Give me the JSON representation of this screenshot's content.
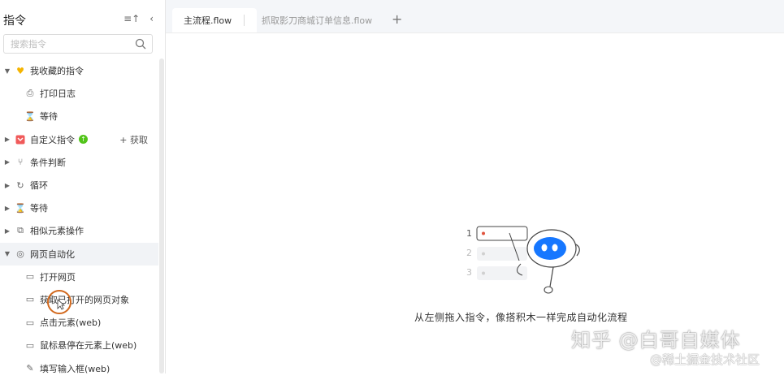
{
  "sidebar": {
    "title": "指令",
    "search_placeholder": "搜索指令",
    "items": [
      {
        "label": "我收藏的指令"
      },
      {
        "label": "打印日志"
      },
      {
        "label": "等待"
      },
      {
        "label": "自定义指令",
        "action": "+ 获取"
      },
      {
        "label": "条件判断"
      },
      {
        "label": "循环"
      },
      {
        "label": "等待"
      },
      {
        "label": "相似元素操作"
      },
      {
        "label": "网页自动化"
      },
      {
        "label": "打开网页"
      },
      {
        "label": "获取已打开的网页对象"
      },
      {
        "label": "点击元素(web)"
      },
      {
        "label": "鼠标悬停在元素上(web)"
      },
      {
        "label": "填写输入框(web)"
      }
    ]
  },
  "tabs": [
    {
      "label": "主流程.flow"
    },
    {
      "label": "抓取影刀商城订单信息.flow"
    }
  ],
  "empty_state": {
    "text": "从左侧拖入指令，像搭积木一样完成自动化流程",
    "steps": [
      "1",
      "2",
      "3"
    ]
  },
  "watermark": {
    "line1": "知乎 @白哥自媒体",
    "line2": "@稀土掘金技术社区"
  },
  "colors": {
    "favorite": "#f5b400",
    "custom": "#f05a5a",
    "badge": "#52c41a",
    "robot": "#1677ff"
  },
  "icons": [
    "sort-icon",
    "collapse-left-icon",
    "search-icon",
    "heart-icon",
    "printer-icon",
    "hourglass-icon",
    "custom-command-icon",
    "condition-icon",
    "loop-icon",
    "similar-elements-icon",
    "web-icon",
    "browser-window-icon",
    "add-tab-icon"
  ]
}
